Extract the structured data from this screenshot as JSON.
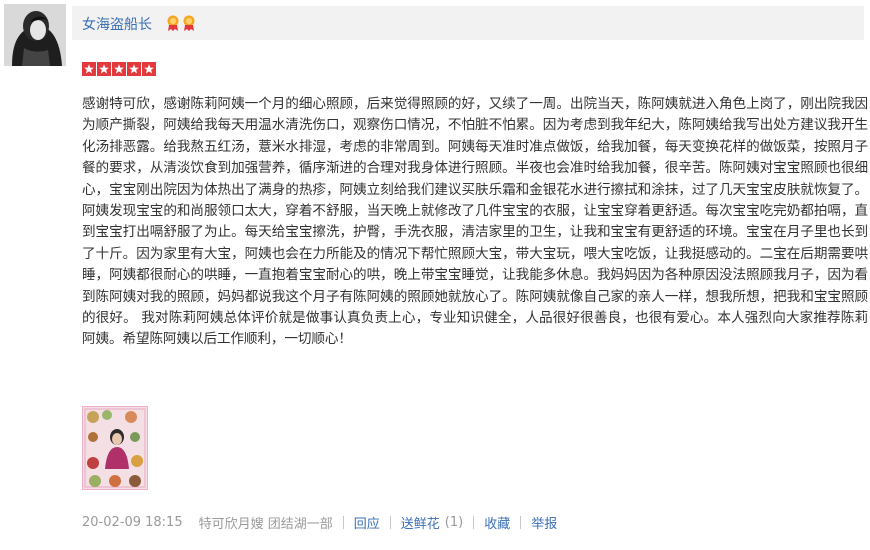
{
  "user": {
    "name": "女海盗船长",
    "avatar_icon": "user-avatar",
    "badges": [
      "medal-icon",
      "medal-icon"
    ]
  },
  "rating": {
    "stars": 5,
    "max": 5,
    "color": "#e4393c"
  },
  "review": {
    "text": "感谢特可欣，感谢陈莉阿姨一个月的细心照顾，后来觉得照顾的好，又续了一周。出院当天，陈阿姨就进入角色上岗了，刚出院我因为顺产撕裂，阿姨给我每天用温水清洗伤口，观察伤口情况，不怕脏不怕累。因为考虑到我年纪大，陈阿姨给我写出处方建议我开生化汤排恶露。给我熬五红汤，薏米水排湿，考虑的非常周到。阿姨每天准时准点做饭，给我加餐，每天变换花样的做饭菜，按照月子餐的要求，从清淡饮食到加强营养，循序渐进的合理对我身体进行照顾。半夜也会准时给我加餐，很辛苦。陈阿姨对宝宝照顾也很细心，宝宝刚出院因为体热出了满身的热疹，阿姨立刻给我们建议买肤乐霜和金银花水进行擦拭和涂抹，过了几天宝宝皮肤就恢复了。阿姨发现宝宝的和尚服领口太大，穿着不舒服，当天晚上就修改了几件宝宝的衣服，让宝宝穿着更舒适。每次宝宝吃完奶都拍嗝，直到宝宝打出嗝舒服了为止。每天给宝宝擦洗，护臀，手洗衣服，清洁家里的卫生，让我和宝宝有更舒适的环境。宝宝在月子里也长到了十斤。因为家里有大宝，阿姨也会在力所能及的情况下帮忙照顾大宝，带大宝玩，喂大宝吃饭，让我挺感动的。二宝在后期需要哄睡，阿姨都很耐心的哄睡，一直抱着宝宝耐心的哄，晚上带宝宝睡觉，让我能多休息。我妈妈因为各种原因没法照顾我月子，因为看到陈阿姨对我的照顾，妈妈都说我这个月子有陈阿姨的照顾她就放心了。陈阿姨就像自己家的亲人一样，想我所想，把我和宝宝照顾的很好。 我对陈莉阿姨总体评价就是做事认真负责上心，专业知识健全，人品很好很善良，也很有爱心。本人强烈向大家推荐陈莉阿姨。希望陈阿姨以后工作顺利，一切顺心！"
  },
  "photo": {
    "icon": "review-photo-thumbnail"
  },
  "footer": {
    "date": "20-02-09 18:15",
    "source": "特可欣月嫂 团结湖一部",
    "reply": "回应",
    "flower": "送鲜花",
    "flower_count": "(1)",
    "favorite": "收藏",
    "report": "举报"
  }
}
